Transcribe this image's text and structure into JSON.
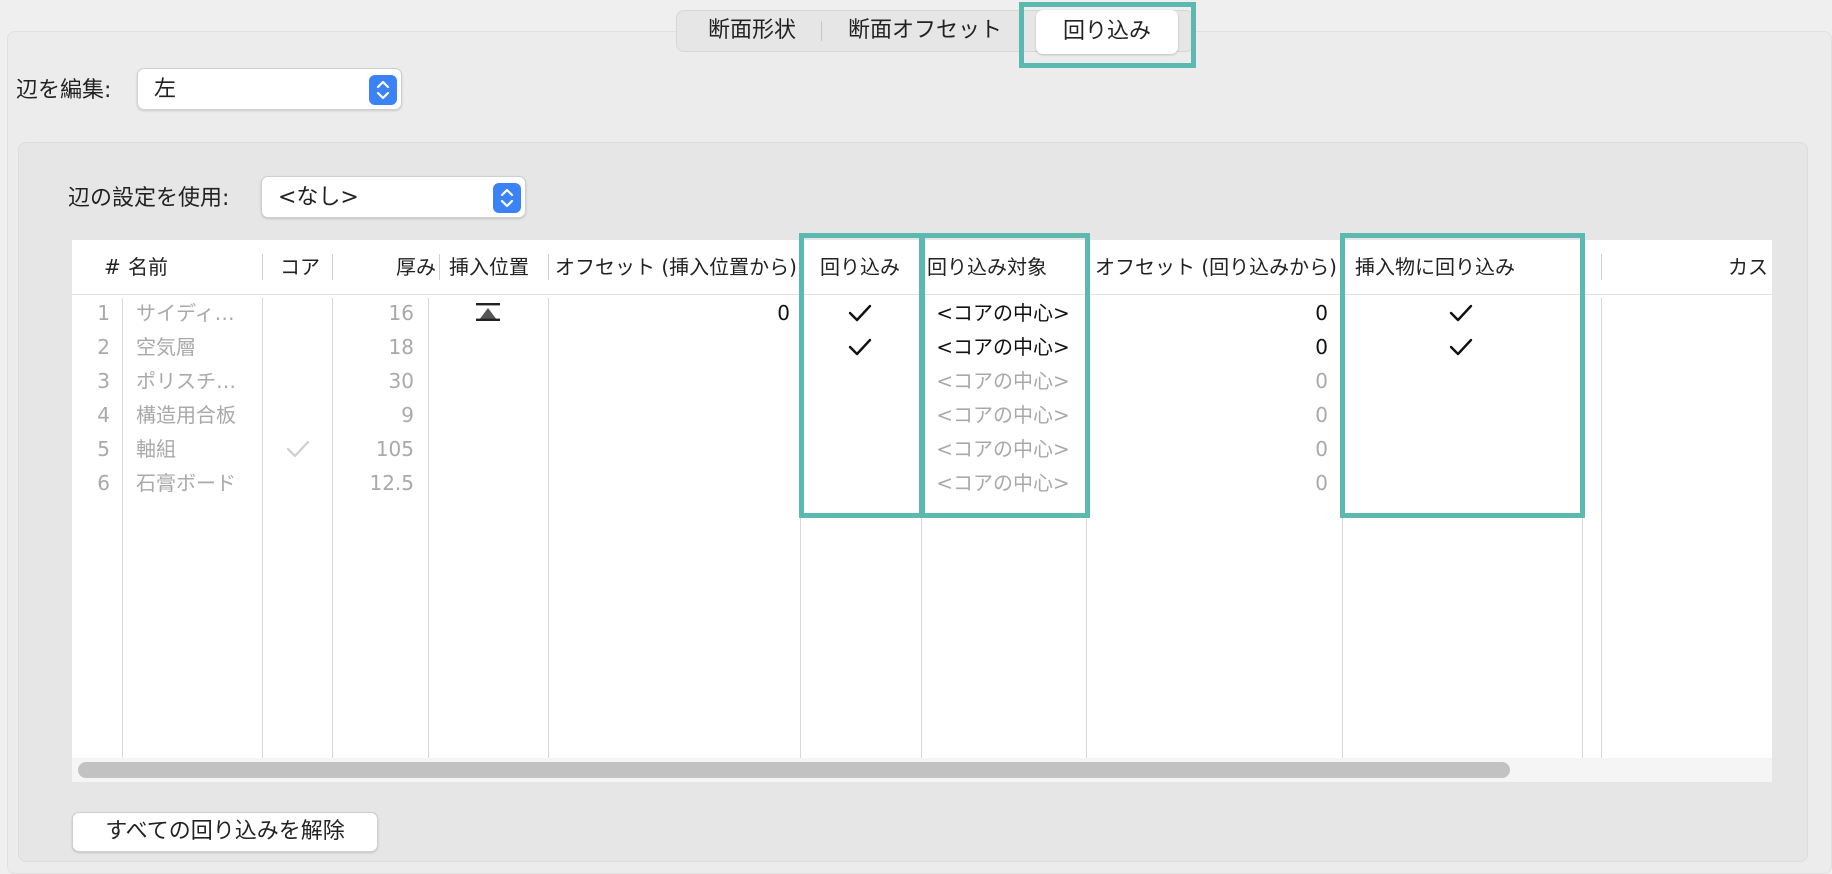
{
  "tabs": [
    "断面形状",
    "断面オフセット",
    "回り込み"
  ],
  "edit_edge": {
    "label": "辺を編集:",
    "value": "左"
  },
  "use_edge_settings": {
    "label": "辺の設定を使用:",
    "value": "<なし>"
  },
  "table": {
    "headers": {
      "num": "#",
      "name": "名前",
      "core": "コア",
      "thickness": "厚み",
      "insert_pos": "挿入位置",
      "offset_insert": "オフセット (挿入位置から)",
      "wrap": "回り込み",
      "wrap_target": "回り込み対象",
      "offset_wrap": "オフセット (回り込みから)",
      "wrap_insert": "挿入物に回り込み",
      "custom": "カス"
    },
    "rows": [
      {
        "num": "1",
        "name": "サイディ…",
        "thickness": "16",
        "offset": "0",
        "target": "<コアの中心>",
        "target_offset": "0"
      },
      {
        "num": "2",
        "name": "空気層",
        "thickness": "18",
        "offset": "",
        "target": "<コアの中心>",
        "target_offset": "0"
      },
      {
        "num": "3",
        "name": "ポリスチ…",
        "thickness": "30",
        "offset": "",
        "target": "<コアの中心>",
        "target_offset": "0"
      },
      {
        "num": "4",
        "name": "構造用合板",
        "thickness": "9",
        "offset": "",
        "target": "<コアの中心>",
        "target_offset": "0"
      },
      {
        "num": "5",
        "name": "軸組",
        "thickness": "105",
        "offset": "",
        "target": "<コアの中心>",
        "target_offset": "0"
      },
      {
        "num": "6",
        "name": "石膏ボード",
        "thickness": "12.5",
        "offset": "",
        "target": "<コアの中心>",
        "target_offset": "0"
      }
    ]
  },
  "clear_button": "すべての回り込みを解除",
  "colors": {
    "highlight": "#5bb9b0",
    "accent": "#3b82f6"
  }
}
